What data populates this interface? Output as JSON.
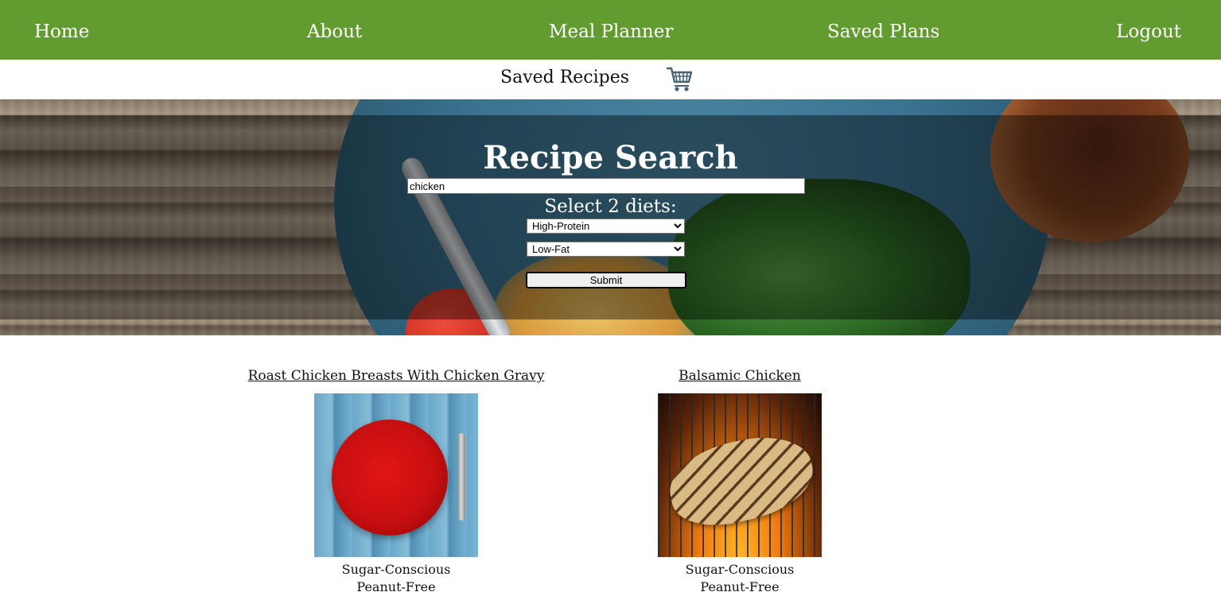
{
  "nav": {
    "home": "Home",
    "about": "About",
    "meal_planner": "Meal Planner",
    "saved_plans": "Saved Plans",
    "logout": "Logout",
    "color": "#629b2f"
  },
  "subbar": {
    "saved_recipes": "Saved Recipes",
    "cart_icon": "shopping-cart-icon"
  },
  "search": {
    "title": "Recipe Search",
    "query": "chicken",
    "diet_label": "Select 2 diets:",
    "diet_1": "High-Protein",
    "diet_2": "Low-Fat",
    "submit": "Submit"
  },
  "results": [
    {
      "title": "Roast Chicken Breasts With Chicken Gravy",
      "image": "red-plate-photo",
      "tags": [
        "Sugar-Conscious",
        "Peanut-Free"
      ]
    },
    {
      "title": "Balsamic Chicken",
      "image": "grilled-chicken-photo",
      "tags": [
        "Sugar-Conscious",
        "Peanut-Free"
      ]
    }
  ]
}
